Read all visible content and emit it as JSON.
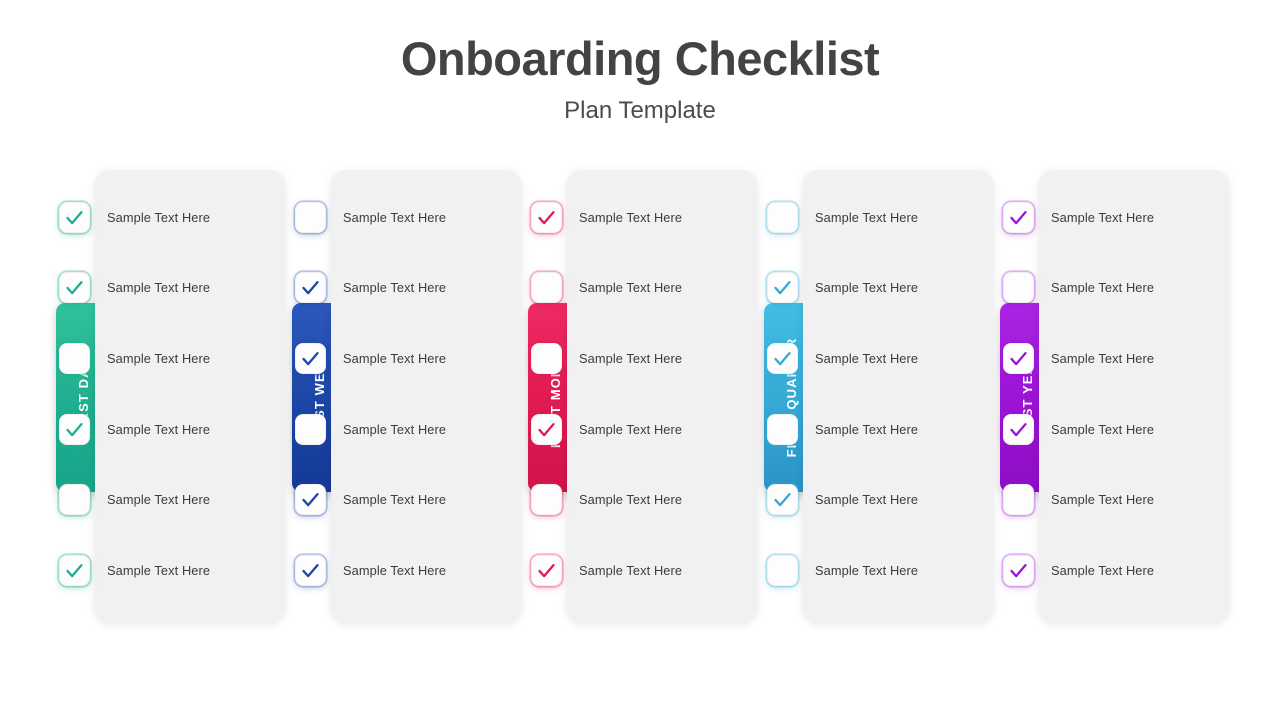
{
  "header": {
    "title": "Onboarding Checklist",
    "subtitle": "Plan Template"
  },
  "colors": {
    "title_text": "#434343",
    "subtitle_text": "#4b4b4b",
    "card_background": "#f1f1f1",
    "row_text": "#3c3c3c",
    "page_background": "#ffffff"
  },
  "item_label": "Sample Text Here",
  "columns": [
    {
      "tab_label": "FIRST DAY",
      "accent": "#1fae8f",
      "accent_dark": "#17a58a",
      "accent_light": "#2fc39c",
      "glow": "rgba(31,174,143,0.35)",
      "items": [
        {
          "label": "Sample Text Here",
          "checked": true
        },
        {
          "label": "Sample Text Here",
          "checked": true
        },
        {
          "label": "Sample Text Here",
          "checked": false
        },
        {
          "label": "Sample Text Here",
          "checked": true
        },
        {
          "label": "Sample Text Here",
          "checked": false
        },
        {
          "label": "Sample Text Here",
          "checked": true
        }
      ]
    },
    {
      "tab_label": "FIRST WEEK",
      "accent": "#1d45a4",
      "accent_dark": "#143a96",
      "accent_light": "#2c58be",
      "glow": "rgba(29,69,164,0.28)",
      "items": [
        {
          "label": "Sample Text Here",
          "checked": false
        },
        {
          "label": "Sample Text Here",
          "checked": true
        },
        {
          "label": "Sample Text Here",
          "checked": true
        },
        {
          "label": "Sample Text Here",
          "checked": false
        },
        {
          "label": "Sample Text Here",
          "checked": true
        },
        {
          "label": "Sample Text Here",
          "checked": true
        }
      ]
    },
    {
      "tab_label": "FIRST MONTH",
      "accent": "#e01a51",
      "accent_dark": "#d2134d",
      "accent_light": "#ef2a63",
      "glow": "rgba(224,26,81,0.30)",
      "items": [
        {
          "label": "Sample Text Here",
          "checked": true
        },
        {
          "label": "Sample Text Here",
          "checked": false
        },
        {
          "label": "Sample Text Here",
          "checked": false
        },
        {
          "label": "Sample Text Here",
          "checked": true
        },
        {
          "label": "Sample Text Here",
          "checked": false
        },
        {
          "label": "Sample Text Here",
          "checked": true
        }
      ]
    },
    {
      "tab_label": "FIRST QUARTER",
      "accent": "#35a8d4",
      "accent_dark": "#2b93c4",
      "accent_light": "#44bde3",
      "glow": "rgba(53,168,212,0.30)",
      "items": [
        {
          "label": "Sample Text Here",
          "checked": false
        },
        {
          "label": "Sample Text Here",
          "checked": true
        },
        {
          "label": "Sample Text Here",
          "checked": true
        },
        {
          "label": "Sample Text Here",
          "checked": false
        },
        {
          "label": "Sample Text Here",
          "checked": true
        },
        {
          "label": "Sample Text Here",
          "checked": false
        }
      ]
    },
    {
      "tab_label": "FIRST YEAR",
      "accent": "#9b13d4",
      "accent_dark": "#8e0ec6",
      "accent_light": "#ab24e4",
      "glow": "rgba(155,19,212,0.28)",
      "items": [
        {
          "label": "Sample Text Here",
          "checked": true
        },
        {
          "label": "Sample Text Here",
          "checked": false
        },
        {
          "label": "Sample Text Here",
          "checked": true
        },
        {
          "label": "Sample Text Here",
          "checked": true
        },
        {
          "label": "Sample Text Here",
          "checked": false
        },
        {
          "label": "Sample Text Here",
          "checked": true
        }
      ]
    }
  ]
}
